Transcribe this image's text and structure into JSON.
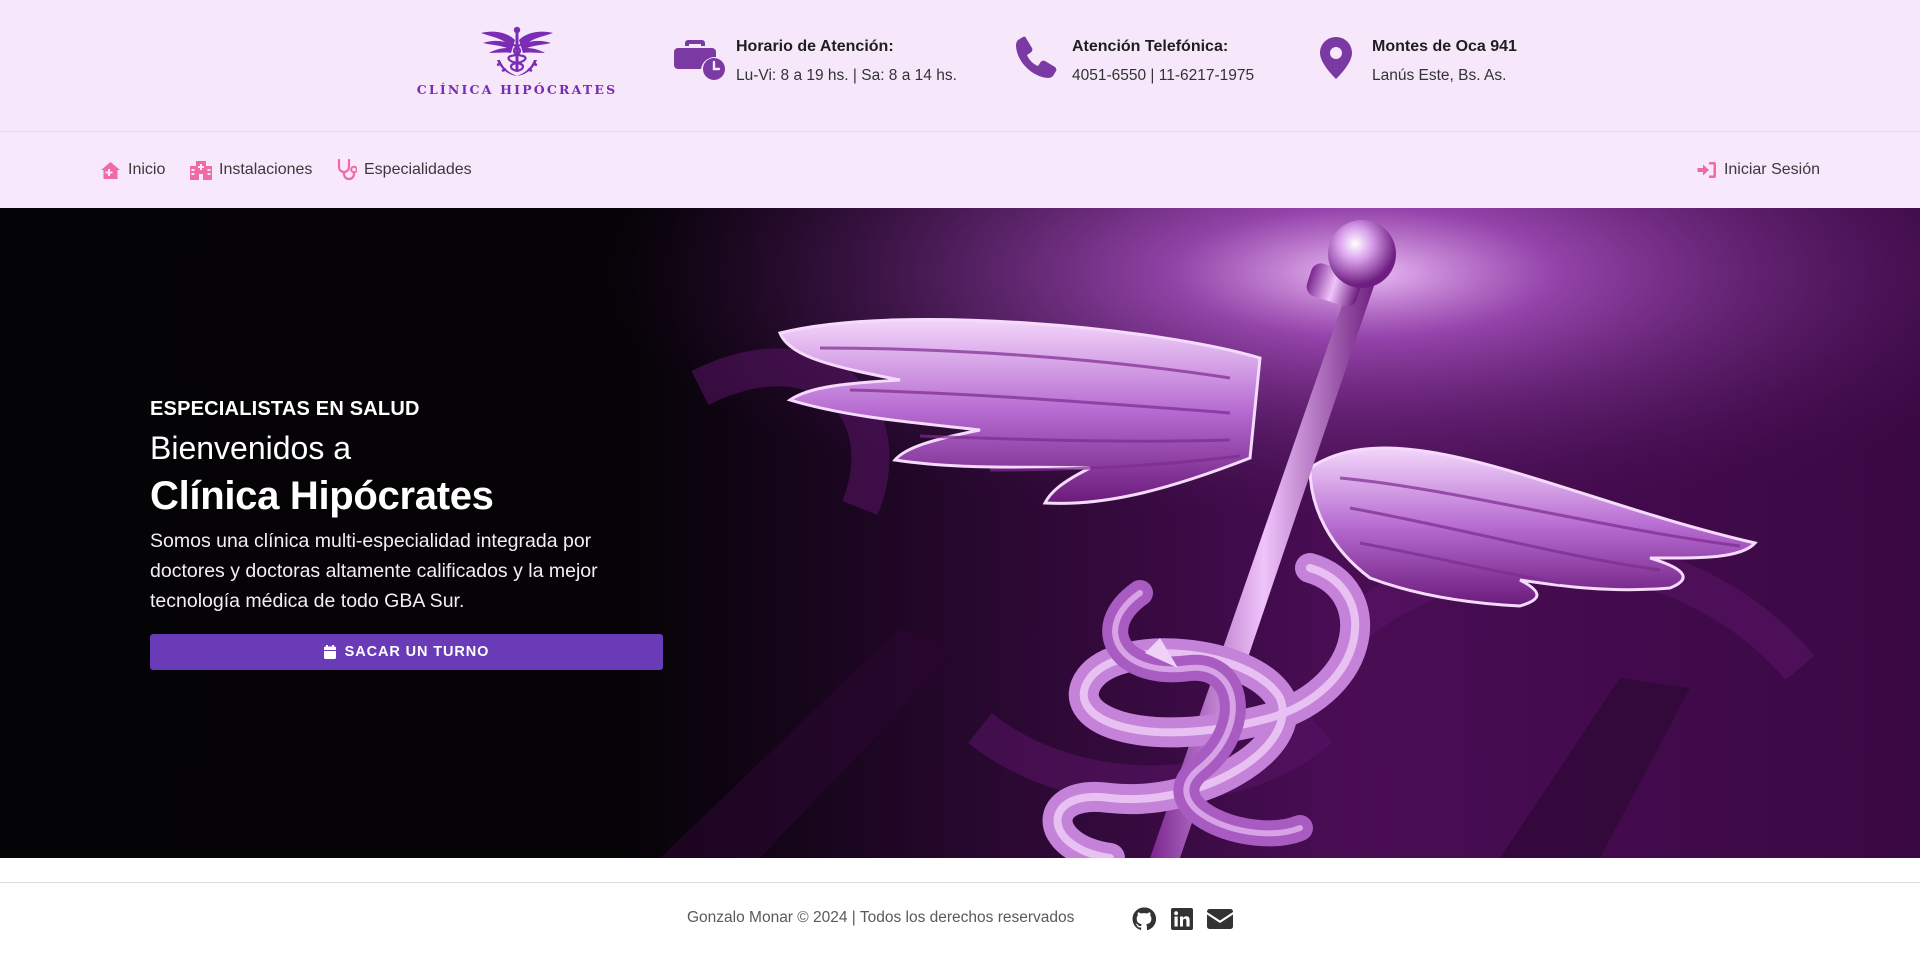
{
  "brand": {
    "name": "CLÍNICA HIPÓCRATES",
    "logo_icon": "caduceus-logo",
    "color": "#7a2db4"
  },
  "info": {
    "hours": {
      "icon": "briefcase-clock-icon",
      "title": "Horario de Atención:",
      "value": "Lu-Vi: 8 a 19 hs. | Sa: 8 a 14 hs."
    },
    "phone": {
      "icon": "phone-icon",
      "title": "Atención Telefónica:",
      "value": "4051-6550 | 11-6217-1975"
    },
    "address": {
      "icon": "map-pin-icon",
      "title": "Montes de Oca 941",
      "value": "Lanús Este, Bs. As."
    }
  },
  "nav": {
    "items": [
      {
        "label": "Inicio",
        "icon": "home-icon"
      },
      {
        "label": "Instalaciones",
        "icon": "hospital-icon"
      },
      {
        "label": "Especialidades",
        "icon": "stethoscope-icon"
      }
    ],
    "login": {
      "label": "Iniciar Sesión",
      "icon": "sign-in-icon"
    }
  },
  "hero": {
    "eyebrow": "ESPECIALISTAS EN SALUD",
    "subtitle": "Bienvenidos a",
    "title": "Clínica Hipócrates",
    "description": "Somos una clínica multi-especialidad integrada por doctores y doctoras altamente calificados y la mejor tecnología médica de todo GBA Sur.",
    "cta_label": "SACAR UN TURNO",
    "cta_icon": "calendar-icon",
    "image": "caduceus-hero-image"
  },
  "footer": {
    "copyright": "Gonzalo Monar © 2024 | Todos los derechos reservados",
    "social": [
      {
        "name": "github-icon"
      },
      {
        "name": "linkedin-icon"
      },
      {
        "name": "email-icon"
      }
    ]
  },
  "colors": {
    "topbar_bg": "#f6e8fa",
    "nav_icon": "#f06aa4",
    "info_icon": "#7b3aa3",
    "cta_bg": "#6a3bb7",
    "hero_accent": "#a24bd0"
  }
}
